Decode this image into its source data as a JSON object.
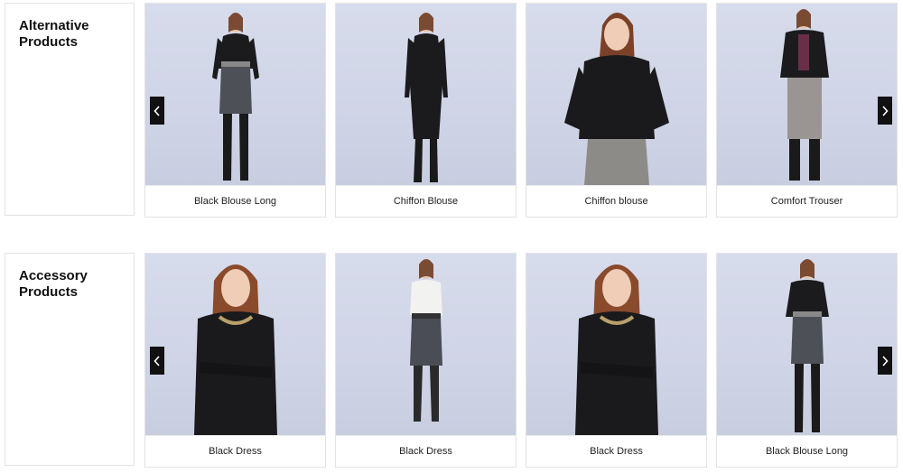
{
  "alternative": {
    "title": "Alternative\nProducts",
    "products": [
      {
        "name": "Black Blouse Long"
      },
      {
        "name": "Chiffon Blouse"
      },
      {
        "name": "Chiffon blouse"
      },
      {
        "name": "Comfort Trouser"
      }
    ]
  },
  "accessory": {
    "title": "Accessory\nProducts",
    "products": [
      {
        "name": "Black Dress"
      },
      {
        "name": "Black Dress"
      },
      {
        "name": "Black Dress"
      },
      {
        "name": "Black Blouse Long"
      }
    ]
  },
  "colors": {
    "photo_bg": "#d7dcec",
    "arrow_bg": "#111111",
    "border": "#e3e3e3"
  },
  "icons": {
    "prev": "chevron-left-icon",
    "next": "chevron-right-icon"
  }
}
